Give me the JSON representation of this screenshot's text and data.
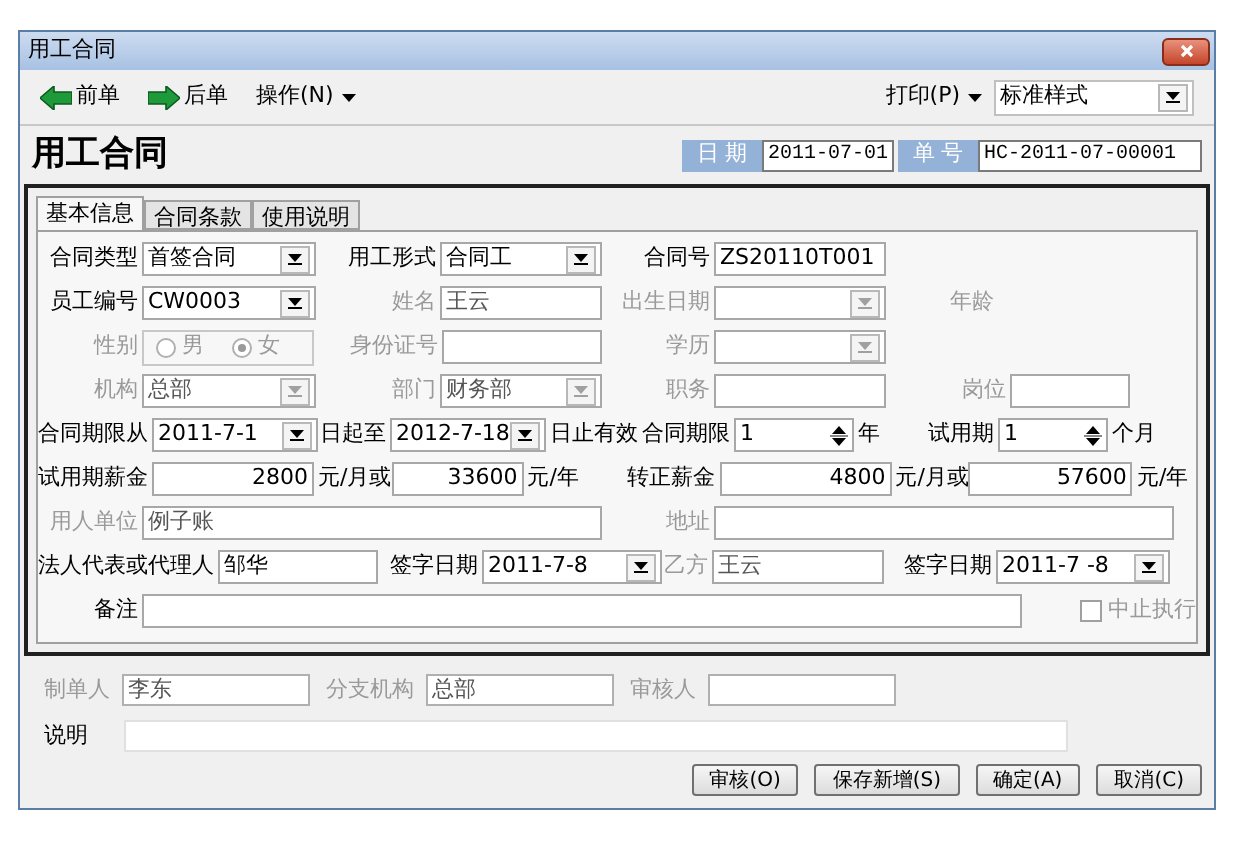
{
  "window": {
    "title": "用工合同"
  },
  "toolbar": {
    "items": [
      {
        "kind": "back",
        "label": "前单"
      },
      {
        "kind": "forward",
        "label": "后单"
      },
      {
        "kind": "menu",
        "label": "操作(N)"
      }
    ],
    "print": "打印(P)",
    "style_select": "标准样式"
  },
  "header": {
    "title": "用工合同",
    "fields": [
      {
        "label": "日 期",
        "value": "2011-07-01"
      },
      {
        "label": "单 号",
        "value": "HC-2011-07-00001"
      }
    ]
  },
  "tabs": [
    {
      "label": "基本信息",
      "selected": true
    },
    {
      "label": "合同条款",
      "selected": false
    },
    {
      "label": "使用说明",
      "selected": false
    }
  ],
  "form_rows": [
    [
      {
        "kind": "select",
        "label": "合同类型",
        "value": "首签合同",
        "disabled": false
      },
      {
        "kind": "select",
        "label": "用工形式",
        "value": "合同工",
        "disabled": false
      },
      {
        "kind": "input",
        "label": "合同号",
        "value": "ZS20110T001",
        "disabled": false
      }
    ],
    [
      {
        "kind": "select",
        "label": "员工编号",
        "value": "CW0003",
        "disabled": false
      },
      {
        "kind": "input",
        "label": "姓名",
        "value": "王云",
        "disabled": true
      },
      {
        "kind": "select",
        "label": "出生日期",
        "disabled": true
      },
      {
        "kind": "label",
        "label": "年龄",
        "disabled": true
      }
    ],
    [
      {
        "kind": "radio",
        "label": "性别",
        "disabled": true,
        "options": [
          {
            "label": "男",
            "selected": false
          },
          {
            "label": "女",
            "selected": true
          }
        ]
      },
      {
        "kind": "input",
        "label": "身份证号",
        "disabled": true
      },
      {
        "kind": "select",
        "label": "学历",
        "disabled": true
      }
    ],
    [
      {
        "kind": "select",
        "label": "机构",
        "value": "总部",
        "disabled": true
      },
      {
        "kind": "select",
        "label": "部门",
        "value": "财务部",
        "disabled": true
      },
      {
        "kind": "input",
        "label": "职务",
        "disabled": true
      },
      {
        "kind": "input",
        "label": "岗位",
        "disabled": true
      }
    ],
    [
      {
        "kind": "select",
        "label": "合同期限从",
        "value": "2011-7-1",
        "disabled": false
      },
      {
        "kind": "select",
        "label": "日起至",
        "value": "2012-7-18",
        "disabled": false
      },
      {
        "kind": "unit",
        "label": "日止有效"
      },
      {
        "kind": "spin",
        "label": "合同期限",
        "value": "1",
        "disabled": false
      },
      {
        "kind": "unit",
        "label": "年"
      },
      {
        "kind": "spin",
        "label": "试用期",
        "value": "1",
        "disabled": false
      },
      {
        "kind": "unit",
        "label": "个月"
      }
    ],
    [
      {
        "kind": "number",
        "label": "试用期薪金",
        "value": "2800",
        "disabled": false
      },
      {
        "kind": "unit",
        "label": "元/月或"
      },
      {
        "kind": "number",
        "value": "33600",
        "disabled": false
      },
      {
        "kind": "unit",
        "label": "元/年"
      },
      {
        "kind": "number",
        "label": "转正薪金",
        "value": "4800",
        "disabled": false
      },
      {
        "kind": "unit",
        "label": "元/月或"
      },
      {
        "kind": "number",
        "value": "57600",
        "disabled": false
      },
      {
        "kind": "unit",
        "label": "元/年"
      }
    ],
    [
      {
        "kind": "input",
        "label": "用人单位",
        "value": "例子账",
        "disabled": true
      },
      {
        "kind": "input",
        "label": "地址",
        "disabled": true
      }
    ],
    [
      {
        "kind": "input",
        "label": "法人代表或代理人",
        "value": "邹华",
        "disabled": false
      },
      {
        "kind": "select",
        "label": "签字日期",
        "value": "2011-7-8",
        "disabled": false
      },
      {
        "kind": "input",
        "label": "乙方",
        "value": "王云",
        "disabled": true
      },
      {
        "kind": "select",
        "label": "签字日期",
        "value": "2011-7 -8",
        "disabled": false
      }
    ],
    [
      {
        "kind": "input",
        "label": "备注",
        "disabled": false
      },
      {
        "kind": "checkbox",
        "label": "中止执行",
        "checked": false,
        "disabled": true
      }
    ]
  ],
  "footer": {
    "fields": [
      {
        "label": "制单人",
        "value": "李东",
        "disabled": true
      },
      {
        "label": "分支机构",
        "value": "总部",
        "disabled": true
      },
      {
        "label": "审核人",
        "disabled": true
      }
    ],
    "note": {
      "label": "说明",
      "disabled": false
    },
    "buttons": [
      "审核(O)",
      "保存新增(S)",
      "确定(A)",
      "取消(C)"
    ]
  }
}
